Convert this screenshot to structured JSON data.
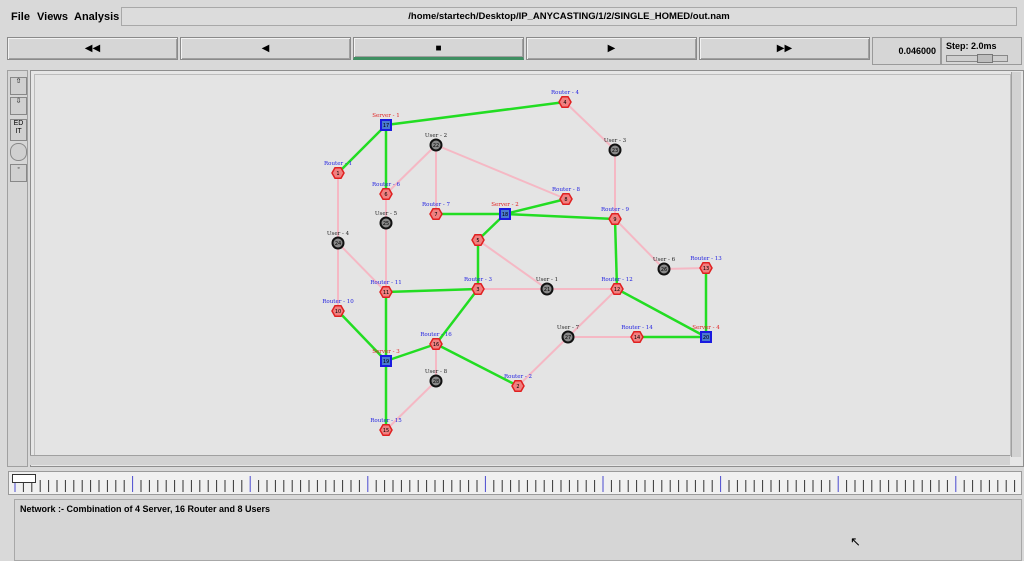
{
  "menu": {
    "file": "File",
    "views": "Views",
    "analysis": "Analysis"
  },
  "window_title": "/home/startech/Desktop/IP_ANYCASTING/1/2/SINGLE_HOMED/out.nam",
  "playback": {
    "rewind_fast": "◀◀",
    "rewind": "◀",
    "stop": "■",
    "play": "▶",
    "forward_fast": "▶▶",
    "time": "0.046000",
    "step": "Step: 2.0ms"
  },
  "toolbar": {
    "edit": "ED IT"
  },
  "status_text": "Network :- Combination of 4 Server, 16 Router and 8 Users",
  "colors": {
    "link_active": "#22dd22",
    "link_idle": "#f5b8c4",
    "router": "#e02020",
    "server": "#1a1ae0",
    "user": "#111111"
  },
  "nodes": [
    {
      "id": "s1",
      "type": "server",
      "label": "Server - 1",
      "num": "17"
    },
    {
      "id": "s2",
      "type": "server",
      "label": "Server - 2",
      "num": "18"
    },
    {
      "id": "s3",
      "type": "server",
      "label": "Server - 3",
      "num": "19"
    },
    {
      "id": "s4",
      "type": "server",
      "label": "Server - 4",
      "num": "20"
    },
    {
      "id": "r1",
      "type": "router",
      "label": "Router - 1",
      "num": "1"
    },
    {
      "id": "r2",
      "type": "router",
      "label": "Router - 2",
      "num": "2"
    },
    {
      "id": "r3",
      "type": "router",
      "label": "Router - 3",
      "num": "3"
    },
    {
      "id": "r4",
      "type": "router",
      "label": "Router - 4",
      "num": "4"
    },
    {
      "id": "r5",
      "type": "router",
      "label": "",
      "num": "5"
    },
    {
      "id": "r6",
      "type": "router",
      "label": "Router - 6",
      "num": "6"
    },
    {
      "id": "r7",
      "type": "router",
      "label": "Router - 7",
      "num": "7"
    },
    {
      "id": "r8",
      "type": "router",
      "label": "Router - 8",
      "num": "8"
    },
    {
      "id": "r9",
      "type": "router",
      "label": "Router - 9",
      "num": "9"
    },
    {
      "id": "r10",
      "type": "router",
      "label": "Router - 10",
      "num": "10"
    },
    {
      "id": "r11",
      "type": "router",
      "label": "Router - 11",
      "num": "11"
    },
    {
      "id": "r12",
      "type": "router",
      "label": "Router - 12",
      "num": "12"
    },
    {
      "id": "r13",
      "type": "router",
      "label": "Router - 13",
      "num": "13"
    },
    {
      "id": "r14",
      "type": "router",
      "label": "Router - 14",
      "num": "14"
    },
    {
      "id": "r15",
      "type": "router",
      "label": "Router - 15",
      "num": "15"
    },
    {
      "id": "r16",
      "type": "router",
      "label": "Router - 16",
      "num": "16"
    },
    {
      "id": "u1",
      "type": "user",
      "label": "User - 1",
      "num": "21"
    },
    {
      "id": "u2",
      "type": "user",
      "label": "User - 2",
      "num": "22"
    },
    {
      "id": "u3",
      "type": "user",
      "label": "User - 3",
      "num": "23"
    },
    {
      "id": "u4",
      "type": "user",
      "label": "User - 4",
      "num": "24"
    },
    {
      "id": "u5",
      "type": "user",
      "label": "User - 5",
      "num": "25"
    },
    {
      "id": "u6",
      "type": "user",
      "label": "User - 6",
      "num": "26"
    },
    {
      "id": "u7",
      "type": "user",
      "label": "User - 7",
      "num": "27"
    },
    {
      "id": "u8",
      "type": "user",
      "label": "User - 8",
      "num": "28"
    }
  ],
  "links": [
    {
      "a": "s1",
      "b": "r4",
      "active": true
    },
    {
      "a": "s1",
      "b": "r1",
      "active": true
    },
    {
      "a": "s1",
      "b": "r6",
      "active": true
    },
    {
      "a": "r4",
      "b": "u3",
      "active": false
    },
    {
      "a": "u3",
      "b": "r9",
      "active": false
    },
    {
      "a": "u2",
      "b": "r6",
      "active": false
    },
    {
      "a": "u2",
      "b": "r7",
      "active": false
    },
    {
      "a": "u2",
      "b": "r8",
      "active": false
    },
    {
      "a": "r8",
      "b": "s2",
      "active": true
    },
    {
      "a": "r7",
      "b": "s2",
      "active": true
    },
    {
      "a": "s2",
      "b": "r9",
      "active": true
    },
    {
      "a": "s2",
      "b": "r5",
      "active": true
    },
    {
      "a": "r5",
      "b": "r3",
      "active": true
    },
    {
      "a": "r5",
      "b": "u1",
      "active": false
    },
    {
      "a": "r9",
      "b": "r12",
      "active": true
    },
    {
      "a": "r9",
      "b": "u6",
      "active": false
    },
    {
      "a": "u6",
      "b": "r13",
      "active": false
    },
    {
      "a": "r13",
      "b": "s4",
      "active": true
    },
    {
      "a": "r12",
      "b": "s4",
      "active": true
    },
    {
      "a": "r12",
      "b": "u1",
      "active": false
    },
    {
      "a": "u1",
      "b": "r3",
      "active": false
    },
    {
      "a": "r3",
      "b": "r11",
      "active": true
    },
    {
      "a": "r3",
      "b": "r16",
      "active": true
    },
    {
      "a": "r1",
      "b": "u4",
      "active": false
    },
    {
      "a": "u4",
      "b": "r10",
      "active": false
    },
    {
      "a": "u4",
      "b": "r11",
      "active": false
    },
    {
      "a": "u5",
      "b": "r11",
      "active": false
    },
    {
      "a": "r6",
      "b": "u5",
      "active": false
    },
    {
      "a": "r11",
      "b": "s3",
      "active": true
    },
    {
      "a": "r10",
      "b": "s3",
      "active": true
    },
    {
      "a": "s3",
      "b": "r16",
      "active": true
    },
    {
      "a": "s3",
      "b": "r15",
      "active": true
    },
    {
      "a": "r16",
      "b": "r2",
      "active": true
    },
    {
      "a": "r16",
      "b": "u8",
      "active": false
    },
    {
      "a": "u8",
      "b": "r15",
      "active": false
    },
    {
      "a": "r2",
      "b": "u7",
      "active": false
    },
    {
      "a": "u7",
      "b": "r12",
      "active": false
    },
    {
      "a": "u7",
      "b": "r14",
      "active": false
    },
    {
      "a": "r14",
      "b": "s4",
      "active": true
    }
  ]
}
